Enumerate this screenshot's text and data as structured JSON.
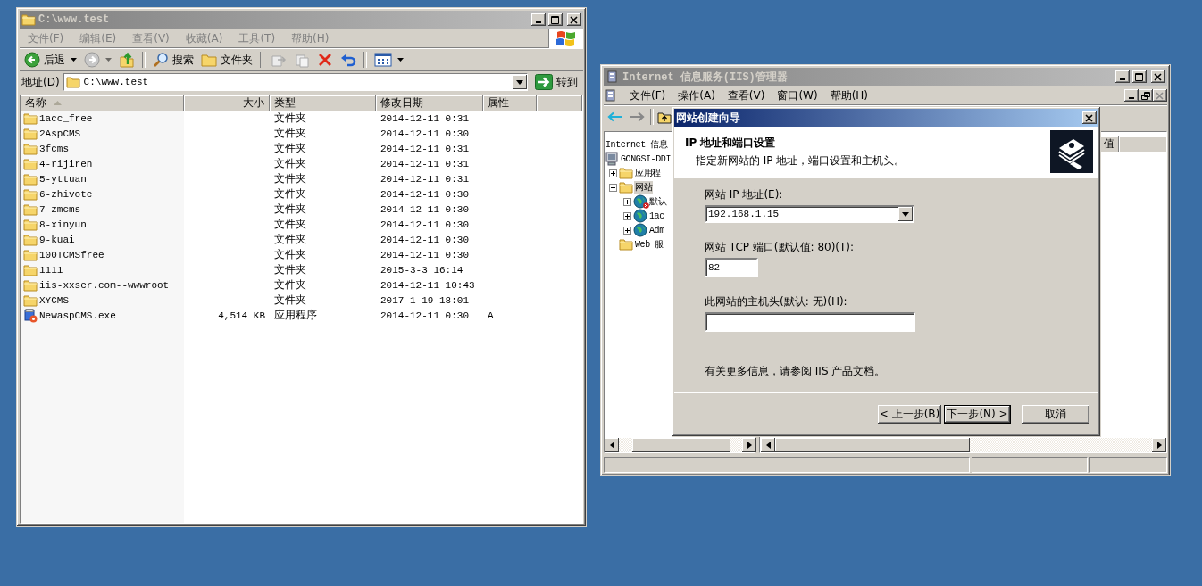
{
  "explorer": {
    "title": "C:\\www.test",
    "active": false,
    "menu": [
      {
        "label": "文件(F)",
        "disabled": true
      },
      {
        "label": "编辑(E)",
        "disabled": true
      },
      {
        "label": "查看(V)",
        "disabled": true
      },
      {
        "label": "收藏(A)",
        "disabled": true
      },
      {
        "label": "工具(T)",
        "disabled": true
      },
      {
        "label": "帮助(H)",
        "disabled": true
      }
    ],
    "toolbar": {
      "back": "后退",
      "search": "搜索",
      "folders": "文件夹"
    },
    "address": {
      "label": "地址(D)",
      "value": "C:\\www.test",
      "go": "转到"
    },
    "columns": [
      {
        "label": "名称",
        "sorted": true
      },
      {
        "label": "大小",
        "sorted": false
      },
      {
        "label": "类型",
        "sorted": false
      },
      {
        "label": "修改日期",
        "sorted": false
      },
      {
        "label": "属性",
        "sorted": false
      }
    ],
    "files": [
      {
        "kind": "folder",
        "name": "1acc_free",
        "type": "文件夹",
        "modified": "2014-12-11 0:31",
        "selected": false
      },
      {
        "kind": "folder",
        "name": "2AspCMS",
        "type": "文件夹",
        "modified": "2014-12-11 0:30",
        "selected": false
      },
      {
        "kind": "folder",
        "name": "3fcms",
        "type": "文件夹",
        "modified": "2014-12-11 0:31",
        "selected": false
      },
      {
        "kind": "folder",
        "name": "4-rijiren",
        "type": "文件夹",
        "modified": "2014-12-11 0:31",
        "selected": false
      },
      {
        "kind": "folder",
        "name": "5-yttuan",
        "type": "文件夹",
        "modified": "2014-12-11 0:31",
        "selected": false
      },
      {
        "kind": "folder",
        "name": "6-zhivote",
        "type": "文件夹",
        "modified": "2014-12-11 0:30",
        "selected": false
      },
      {
        "kind": "folder",
        "name": "7-zmcms",
        "type": "文件夹",
        "modified": "2014-12-11 0:30",
        "selected": false
      },
      {
        "kind": "folder",
        "name": "8-xinyun",
        "type": "文件夹",
        "modified": "2014-12-11 0:30",
        "selected": false
      },
      {
        "kind": "folder",
        "name": "9-kuai",
        "type": "文件夹",
        "modified": "2014-12-11 0:30",
        "selected": false
      },
      {
        "kind": "folder",
        "name": "100TCMSfree",
        "type": "文件夹",
        "modified": "2014-12-11 0:30",
        "selected": false
      },
      {
        "kind": "folder",
        "name": "1111",
        "type": "文件夹",
        "modified": "2015-3-3 16:14",
        "selected": false
      },
      {
        "kind": "folder",
        "name": "iis-xxser.com--wwwroot",
        "type": "文件夹",
        "modified": "2014-12-11 10:43",
        "selected": false
      },
      {
        "kind": "folder",
        "name": "XYCMS",
        "type": "文件夹",
        "modified": "2017-1-19 18:01",
        "selected": false
      },
      {
        "kind": "program",
        "name": "NewaspCMS.exe",
        "size": "4,514 KB",
        "type": "应用程序",
        "modified": "2014-12-11 0:30",
        "attributes": "A",
        "selected": false
      }
    ]
  },
  "iis": {
    "title": "Internet 信息服务(IIS)管理器",
    "active": false,
    "menu": [
      {
        "label": "文件(F)",
        "disabled": false
      },
      {
        "label": "操作(A)",
        "disabled": false
      },
      {
        "label": "查看(V)",
        "disabled": false
      },
      {
        "label": "窗口(W)",
        "disabled": false
      },
      {
        "label": "帮助(H)",
        "disabled": false
      }
    ],
    "tree": [
      {
        "label": "Internet 信息",
        "selected": false,
        "children": [
          {
            "kind": "computer",
            "label": "GONGSI-DDI",
            "selected": false,
            "children": [
              {
                "kind": "folder",
                "label": "应用程",
                "selected": false,
                "expanded": false
              },
              {
                "kind": "folder",
                "label": "网站",
                "selected": true,
                "expanded": true,
                "children": [
                  {
                    "kind": "site",
                    "label": "默认",
                    "selected": false,
                    "expanded": false,
                    "stopped": true
                  },
                  {
                    "kind": "site",
                    "label": "1ac",
                    "selected": false,
                    "expanded": false,
                    "stopped": false
                  },
                  {
                    "kind": "site",
                    "label": "Adm",
                    "selected": false,
                    "expanded": false,
                    "stopped": false
                  }
                ]
              },
              {
                "kind": "folder",
                "label": "Web 服",
                "selected": false
              }
            ]
          }
        ]
      }
    ],
    "columns": [
      "值"
    ]
  },
  "wizard": {
    "title": "网站创建向导",
    "active": true,
    "heading": "IP 地址和端口设置",
    "subheading": "指定新网站的 IP 地址，端口设置和主机头。",
    "ip_label": "网站 IP 地址(E):",
    "ip_value": "192.168.1.15",
    "port_label": "网站 TCP 端口(默认值: 80)(T):",
    "port_value": "82",
    "host_label": "此网站的主机头(默认: 无)(H):",
    "info": "有关更多信息，请参阅 IIS 产品文档。",
    "buttons": [
      {
        "label": "< 上一步(B)",
        "default": false
      },
      {
        "label": "下一步(N) >",
        "default": true
      },
      {
        "label": "取消",
        "default": false
      }
    ]
  }
}
